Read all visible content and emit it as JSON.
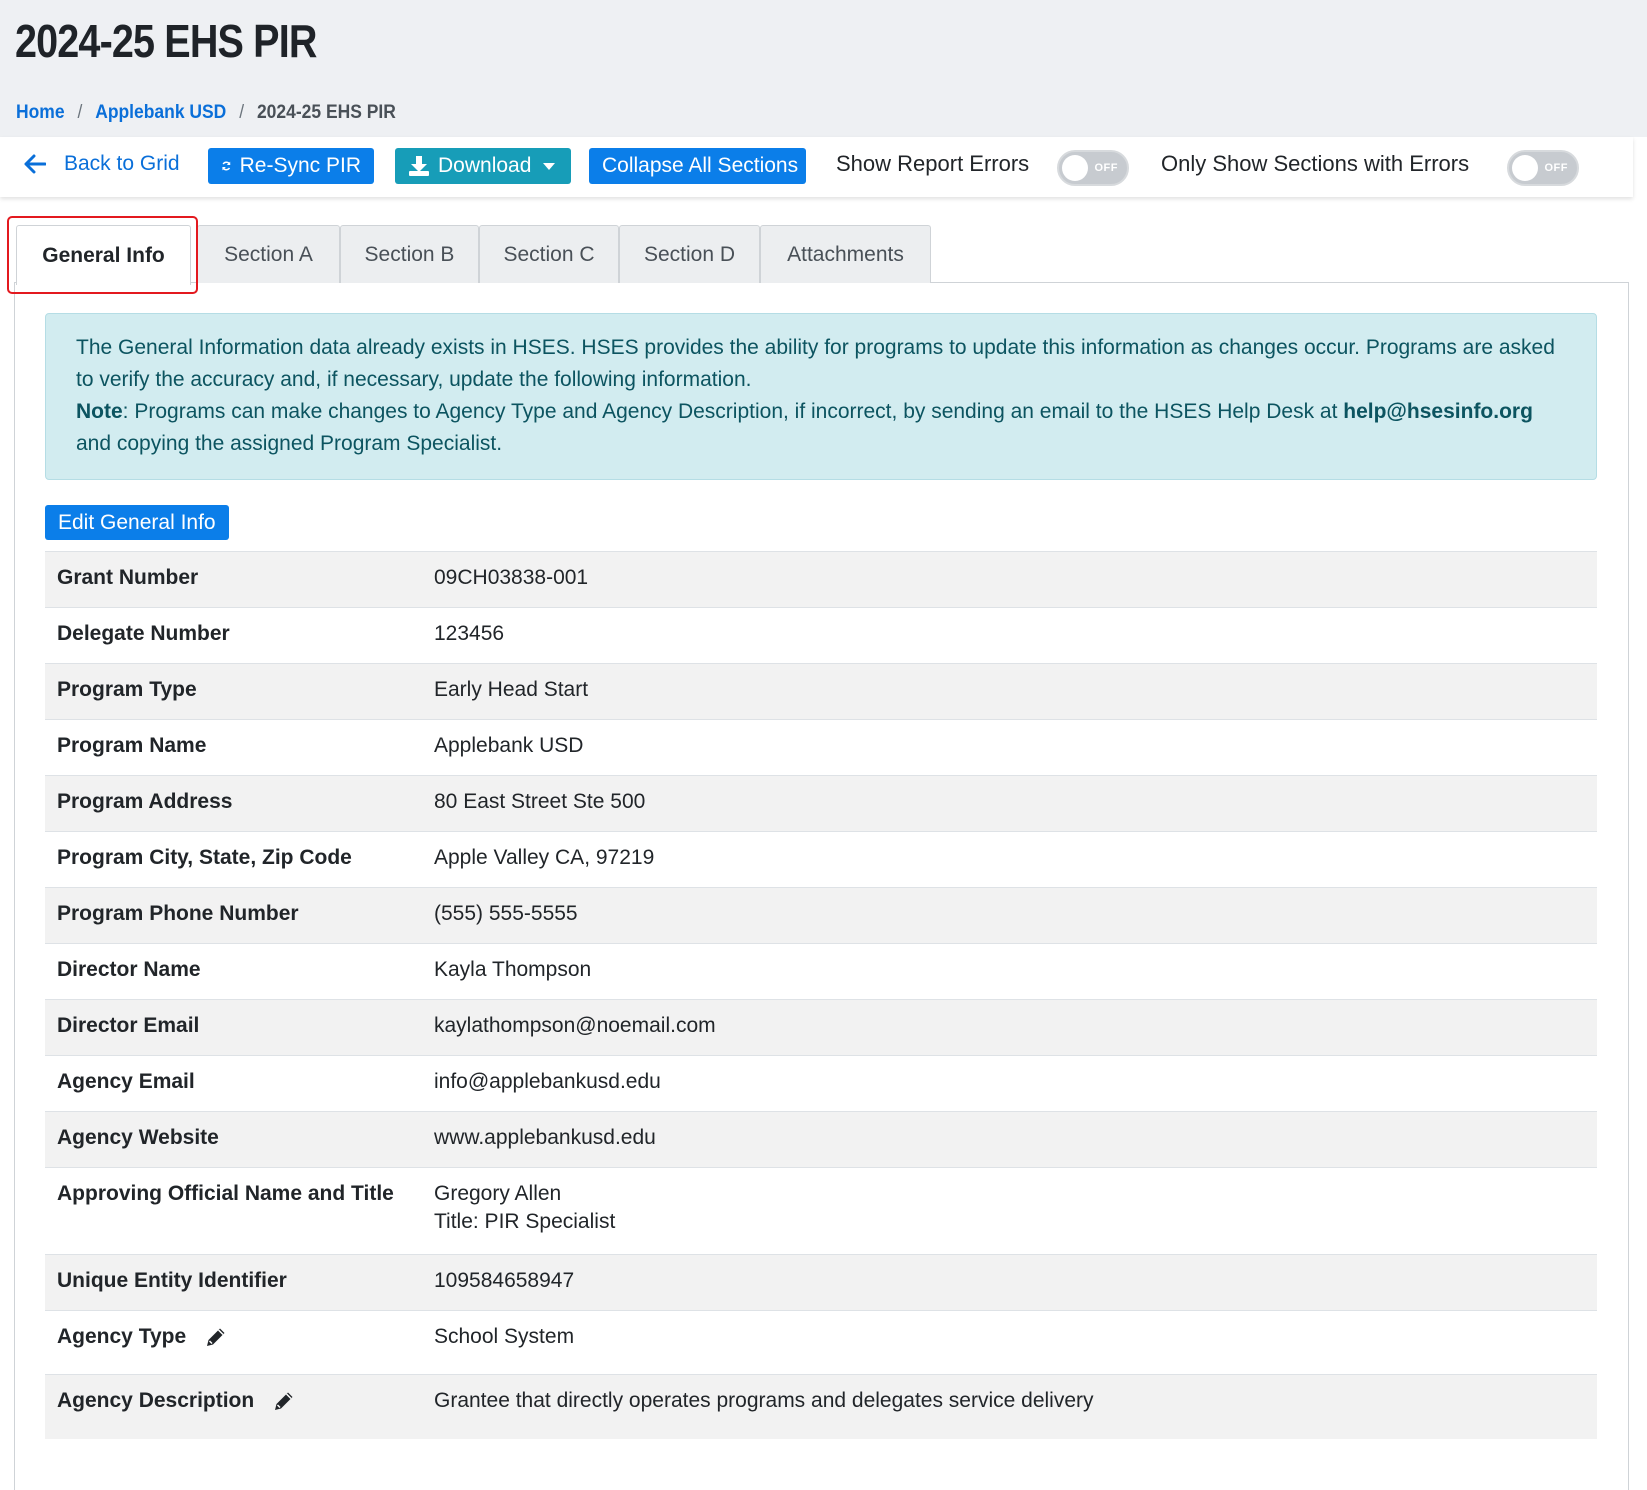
{
  "header": {
    "title": "2024-25 EHS PIR",
    "breadcrumb": [
      {
        "label": "Home"
      },
      {
        "label": "Applebank USD"
      },
      {
        "label": "2024-25 EHS PIR"
      }
    ],
    "breadcrumb_separator": "/"
  },
  "toolbar": {
    "back_label": "Back to Grid",
    "resync_label": "Re-Sync PIR",
    "download_label": "Download",
    "collapse_label": "Collapse All Sections",
    "show_errors_label": "Show Report Errors",
    "show_errors_state": "OFF",
    "only_errors_label": "Only Show Sections with Errors",
    "only_errors_state": "OFF"
  },
  "tabs": [
    {
      "label": "General Info",
      "active": true
    },
    {
      "label": "Section A"
    },
    {
      "label": "Section B"
    },
    {
      "label": "Section C"
    },
    {
      "label": "Section D"
    },
    {
      "label": "Attachments"
    }
  ],
  "alert": {
    "text1": "The General Information data already exists in HSES. HSES provides the ability for programs to update this information as changes occur. Programs are asked to verify the accuracy and, if necessary, update the following information.",
    "note_label": "Note",
    "note_text": ": Programs can make changes to Agency Type and Agency Description, if incorrect, by sending an email to the HSES Help Desk at ",
    "email": "help@hsesinfo.org",
    "text_end": " and copying the assigned Program Specialist."
  },
  "edit_button_label": "Edit General Info",
  "info_rows": [
    {
      "label": "Grant Number",
      "value": "09CH03838-001"
    },
    {
      "label": "Delegate Number",
      "value": "123456"
    },
    {
      "label": "Program Type",
      "value": "Early Head Start"
    },
    {
      "label": "Program Name",
      "value": "Applebank USD"
    },
    {
      "label": "Program Address",
      "value": "80 East Street Ste 500"
    },
    {
      "label": "Program City, State, Zip Code",
      "value": "Apple Valley CA, 97219"
    },
    {
      "label": "Program Phone Number",
      "value": "(555) 555-5555"
    },
    {
      "label": "Director Name",
      "value": "Kayla Thompson"
    },
    {
      "label": "Director Email",
      "value": "kaylathompson@noemail.com"
    },
    {
      "label": "Agency Email",
      "value": "info@applebankusd.edu"
    },
    {
      "label": "Agency Website",
      "value": "www.applebankusd.edu"
    },
    {
      "label": "Approving Official Name and Title",
      "value": "Gregory Allen",
      "value2": "Title: PIR Specialist"
    },
    {
      "label": "Unique Entity Identifier",
      "value": "109584658947"
    },
    {
      "label": "Agency Type",
      "value": "School System",
      "editable_icon": "pencil-icon"
    },
    {
      "label": "Agency Description",
      "value": "Grantee that directly operates programs and delegates service delivery",
      "editable_icon": "pencil-icon"
    }
  ],
  "colors": {
    "primary": "#0b7ee9",
    "info": "#179db8",
    "alert_bg": "#d2ecf0",
    "highlight": "#e3191f"
  }
}
